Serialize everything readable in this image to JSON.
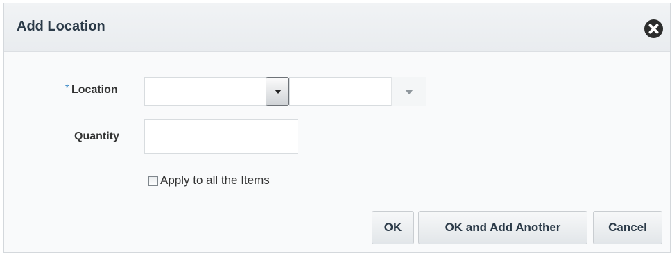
{
  "dialog": {
    "title": "Add Location"
  },
  "form": {
    "location_label": "Location",
    "required_marker": "*",
    "location_type_value": "",
    "location_value": "",
    "quantity_label": "Quantity",
    "quantity_value": "",
    "apply_all_label": "Apply to all the Items",
    "apply_all_checked": false
  },
  "buttons": {
    "ok": "OK",
    "ok_add_another": "OK and Add Another",
    "cancel": "Cancel"
  },
  "icons": {
    "close": "close-icon",
    "dropdown": "chevron-down-icon"
  },
  "colors": {
    "required": "#2a7fc2",
    "title": "#2b3a48"
  }
}
